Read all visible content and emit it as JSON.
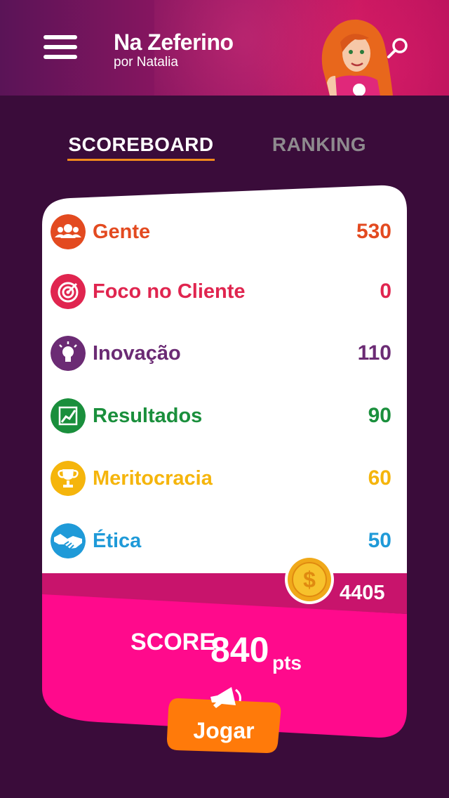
{
  "header": {
    "title": "Na Zeferino",
    "subtitle": "por Natalia",
    "menu_icon": "hamburger-menu-icon",
    "search_icon": "search-icon"
  },
  "tabs": [
    {
      "label": "SCOREBOARD",
      "active": true
    },
    {
      "label": "RANKING",
      "active": false
    }
  ],
  "categories": [
    {
      "label": "Gente",
      "value": "530",
      "color": "#e34a20",
      "icon": "people-icon"
    },
    {
      "label": "Foco no Cliente",
      "value": "0",
      "color": "#e0254f",
      "icon": "target-icon"
    },
    {
      "label": "Inovação",
      "value": "110",
      "color": "#6b2b74",
      "icon": "lightbulb-icon"
    },
    {
      "label": "Resultados",
      "value": "90",
      "color": "#1a8f3c",
      "icon": "chart-icon"
    },
    {
      "label": "Meritocracia",
      "value": "60",
      "color": "#f5b50c",
      "icon": "trophy-icon"
    },
    {
      "label": "Ética",
      "value": "50",
      "color": "#1f9ad8",
      "icon": "handshake-icon"
    }
  ],
  "coins": {
    "value": "4405",
    "icon": "coin-icon"
  },
  "score": {
    "label": "SCORE",
    "value": "840",
    "unit": "pts"
  },
  "play": {
    "label": "Jogar",
    "icon": "megaphone-icon"
  },
  "colors": {
    "background": "#3a0c3a",
    "accent_pink": "#ff0a8c",
    "accent_orange": "#ff7a0a",
    "tab_underline": "#f28a1c"
  }
}
